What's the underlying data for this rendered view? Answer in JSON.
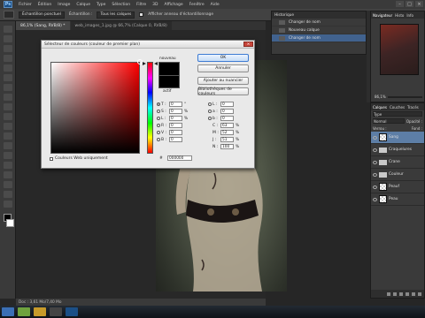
{
  "menu": {
    "logo": "Ps",
    "items": [
      "Fichier",
      "Édition",
      "Image",
      "Calque",
      "Type",
      "Sélection",
      "Filtre",
      "3D",
      "Affichage",
      "Fenêtre",
      "Aide"
    ],
    "window_buttons": [
      "–",
      "□",
      "×"
    ]
  },
  "options_bar": {
    "size_label": "Échantillon ponctuel",
    "sample_label": "Échantillon :",
    "sample_value": "Tous les calques",
    "show_ring_label": "Afficher anneau d'échantillonnage"
  },
  "doc_tabs": [
    {
      "label": "86,1% (Sang, RVB/8) *",
      "active": true
    },
    {
      "label": "web_images_1.jpg @ 66,7% (Calque 0, RVB/8)",
      "active": false
    }
  ],
  "history": {
    "title": "Historique",
    "items": [
      "Changer de nom",
      "Nouveau calque",
      "Changer de nom"
    ],
    "selected_index": 2
  },
  "navigator": {
    "tabs": [
      "Navigateur",
      "Histo",
      "Info"
    ],
    "zoom": "86,1%"
  },
  "layers": {
    "tabs": [
      "Calques",
      "Couches",
      "Tracés"
    ],
    "kind_label": "Type",
    "mode_label": "Normal",
    "opacity_label": "Opacité :",
    "lock_label": "Verrou :",
    "fill_label": "Fond :",
    "items": [
      {
        "name": "Sang",
        "kind": "layer",
        "selected": true
      },
      {
        "name": "Craquelures",
        "kind": "folder",
        "selected": false
      },
      {
        "name": "Crane",
        "kind": "folder",
        "selected": false
      },
      {
        "name": "Couleur",
        "kind": "folder",
        "selected": false
      },
      {
        "name": "Peauf",
        "kind": "layer",
        "selected": false
      },
      {
        "name": "Peau",
        "kind": "layer",
        "selected": false
      }
    ]
  },
  "status_bar": {
    "text": "Doc : 3,61 Mo/7,40 Mo"
  },
  "color_picker": {
    "title": "Sélecteur de couleurs (couleur de premier plan)",
    "new_label": "nouveau",
    "current_label": "actif",
    "buttons": {
      "ok": "OK",
      "cancel": "Annuler",
      "add_swatch": "Ajouter au nuancier",
      "libraries": "Bibliothèques de couleurs"
    },
    "web_only_label": "Couleurs Web uniquement",
    "hsb": [
      {
        "label": "T :",
        "value": "0",
        "unit": "°",
        "selected": true
      },
      {
        "label": "S :",
        "value": "0",
        "unit": "%",
        "selected": false
      },
      {
        "label": "L :",
        "value": "0",
        "unit": "%",
        "selected": false
      }
    ],
    "rgb": [
      {
        "label": "R :",
        "value": "0"
      },
      {
        "label": "V :",
        "value": "0"
      },
      {
        "label": "B :",
        "value": "0"
      }
    ],
    "lab": [
      {
        "label": "L :",
        "value": "0"
      },
      {
        "label": "a :",
        "value": "0"
      },
      {
        "label": "b :",
        "value": "0"
      }
    ],
    "cmyk": [
      {
        "label": "C :",
        "value": "63",
        "unit": "%"
      },
      {
        "label": "M :",
        "value": "52",
        "unit": "%"
      },
      {
        "label": "J :",
        "value": "51",
        "unit": "%"
      },
      {
        "label": "N :",
        "value": "100",
        "unit": "%"
      }
    ],
    "hex_label": "#",
    "hex_value": "000000",
    "new_color": "#000000",
    "current_color": "#000000"
  }
}
